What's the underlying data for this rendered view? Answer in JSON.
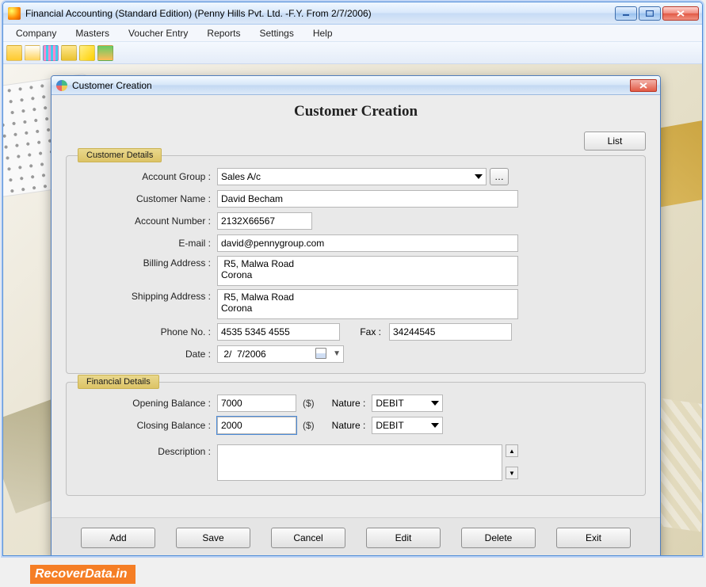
{
  "window_title": "Financial Accounting (Standard Edition) (Penny Hills Pvt. Ltd. -F.Y. From 2/7/2006)",
  "menu": {
    "company": "Company",
    "masters": "Masters",
    "voucher": "Voucher Entry",
    "reports": "Reports",
    "settings": "Settings",
    "help": "Help"
  },
  "modal": {
    "title": "Customer Creation",
    "heading": "Customer Creation",
    "list_btn": "List",
    "cust_legend": "Customer Details",
    "fin_legend": "Financial Details",
    "labels": {
      "account_group": "Account Group :",
      "customer_name": "Customer Name :",
      "account_number": "Account Number :",
      "email": "E-mail :",
      "billing": "Billing Address :",
      "shipping": "Shipping Address :",
      "phone": "Phone No. :",
      "fax": "Fax :",
      "date": "Date :",
      "opening": "Opening Balance :",
      "closing": "Closing Balance :",
      "nature": "Nature :",
      "description": "Description :"
    },
    "values": {
      "account_group": "Sales A/c",
      "customer_name": "David Becham",
      "account_number": "2132X66567",
      "email": "david@pennygroup.com",
      "billing": " R5, Malwa Road\nCorona",
      "shipping": " R5, Malwa Road\nCorona",
      "phone": "4535 5345 4555",
      "fax": "34244545",
      "date": " 2/  7/2006",
      "opening": "7000",
      "closing": "2000",
      "currency": "($)",
      "nature1": "DEBIT",
      "nature2": "DEBIT",
      "description": ""
    },
    "buttons": {
      "add": "Add",
      "save": "Save",
      "cancel": "Cancel",
      "edit": "Edit",
      "delete": "Delete",
      "exit": "Exit"
    }
  },
  "watermark": "RecoverData.in"
}
